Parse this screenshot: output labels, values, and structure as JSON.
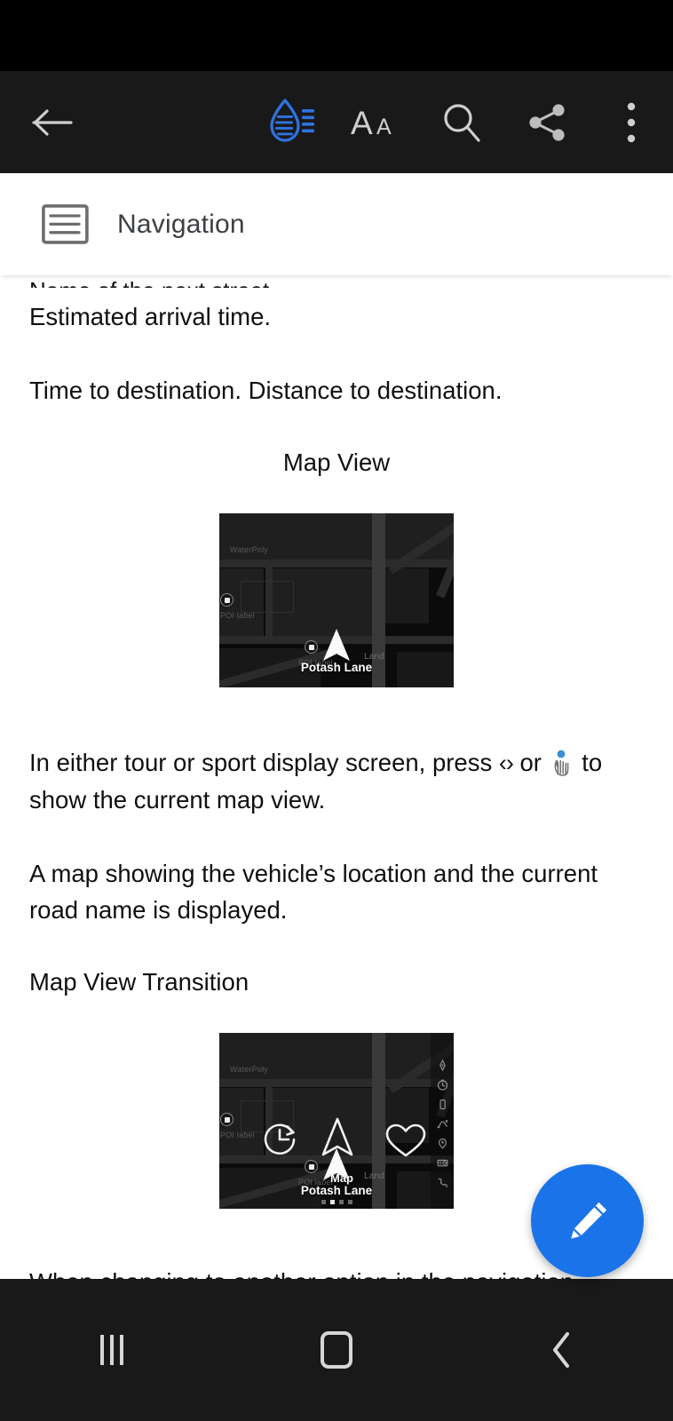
{
  "app": {
    "toolbar": {
      "back_label": "Back",
      "theme_icon": "water-drop-reading-mode-icon",
      "text_size_label": "Aa",
      "search_icon": "search-icon",
      "share_icon": "share-icon",
      "overflow_icon": "more-vertical-icon",
      "accent_color": "#2f73e0"
    },
    "navbar": {
      "recents_label": "Recents",
      "home_label": "Home",
      "back_label": "Back"
    },
    "fab": {
      "icon": "pencil-edit-icon",
      "label": "Edit",
      "color": "#1a73e8"
    }
  },
  "header": {
    "icon": "document-list-icon",
    "title": "Navigation"
  },
  "content": {
    "clipped_top_line": "Name of the next street.",
    "paragraph_1": "Estimated arrival time.",
    "paragraph_2": "Time to destination. Distance to destination.",
    "caption_map_view": "Map View",
    "instruction_prefix": "In either tour or sport display screen, press ",
    "instruction_chevrons": "‹›",
    "instruction_middle": " or ",
    "instruction_suffix": " to show the current map view.",
    "paragraph_3": "A map showing the vehicle’s location and the current road name is displayed.",
    "subheading_transition": "Map View Transition",
    "paragraph_4": "When changing to another option in the navigation menu, the option icon is briefly displayed confirming that a different option has been selected."
  },
  "figures": {
    "map_view": {
      "name": "map-view-figure",
      "labels": {
        "water_poly": "WaterPoly",
        "poi_label_left": "POI label",
        "poi_label_center": "POI label",
        "land": "Land",
        "road_name": "Potash Lane"
      }
    },
    "map_view_transition": {
      "name": "map-view-transition-figure",
      "labels": {
        "water_poly": "WaterPoly",
        "poi_label_left": "POI label",
        "poi_label_center": "POI label",
        "land": "Land",
        "road_name": "Potash Lane",
        "mode_name": "Map"
      },
      "option_icons": [
        "recent-history-icon",
        "navigation-arrow-icon",
        "favorites-heart-icon"
      ],
      "rail_icons": [
        "compass-icon",
        "clock-icon",
        "phone-device-icon",
        "route-icon",
        "location-pin-icon",
        "speed-camera-icon",
        "phone-call-icon"
      ],
      "page_dots": {
        "count": 4,
        "active_index": 1
      }
    }
  }
}
